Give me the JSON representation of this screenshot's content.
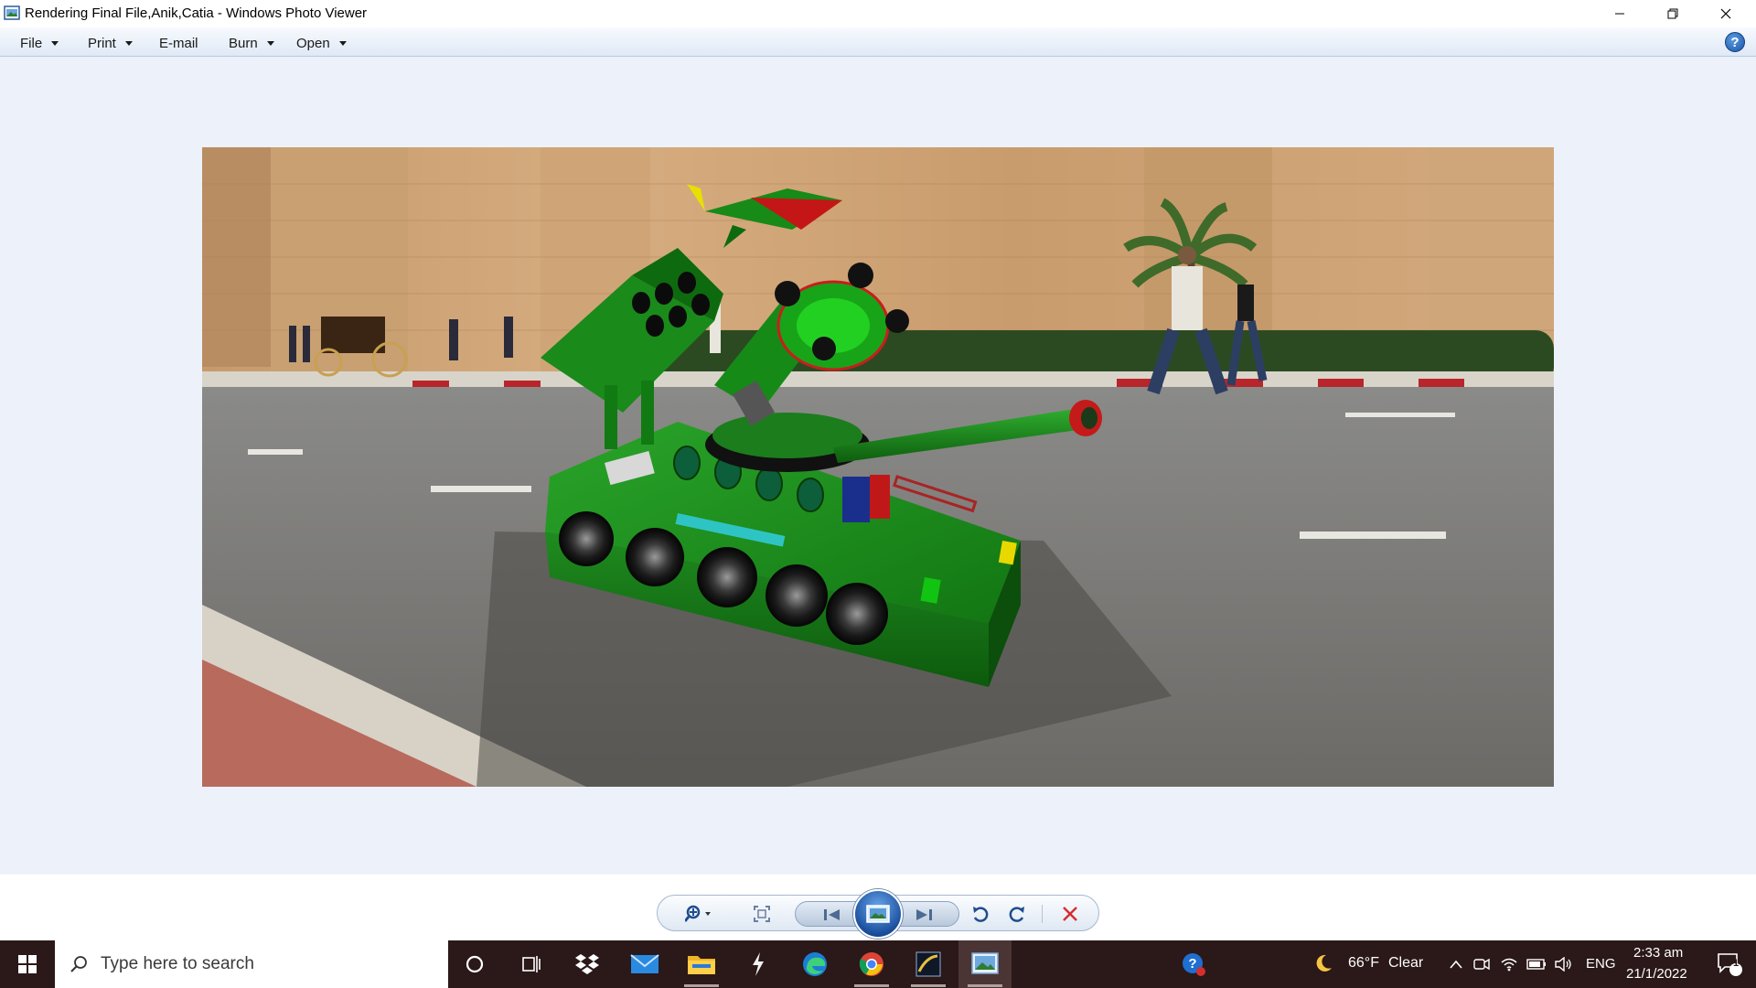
{
  "window": {
    "title": "Rendering Final File,Anik,Catia - Windows Photo Viewer"
  },
  "menu": {
    "items": [
      {
        "label": "File",
        "has_dropdown": true
      },
      {
        "label": "Print",
        "has_dropdown": true
      },
      {
        "label": "E-mail",
        "has_dropdown": false
      },
      {
        "label": "Burn",
        "has_dropdown": true
      },
      {
        "label": "Open",
        "has_dropdown": true
      }
    ],
    "help_label": "?"
  },
  "photo": {
    "subject": "rendered green missile-launcher tank on a street in front of a stone fortress wall"
  },
  "controls": {
    "items": [
      "zoom",
      "actual-size",
      "previous",
      "play-slideshow",
      "next",
      "rotate-counterclockwise",
      "rotate-clockwise",
      "delete"
    ]
  },
  "taskbar": {
    "search_placeholder": "Type here to search",
    "pinned": [
      "cortana",
      "task-view",
      "dropbox",
      "mail",
      "file-explorer",
      "winamp",
      "edge",
      "chrome",
      "catia",
      "photo-viewer"
    ],
    "weather": {
      "temp": "66°F",
      "condition": "Clear"
    },
    "language": "ENG",
    "time": "2:33 am",
    "date": "21/1/2022",
    "notification_count": "1"
  },
  "colors": {
    "taskbar_bg": "#2b1818",
    "accent_blue": "#1b56a6",
    "delete_red": "#d32f2f"
  }
}
